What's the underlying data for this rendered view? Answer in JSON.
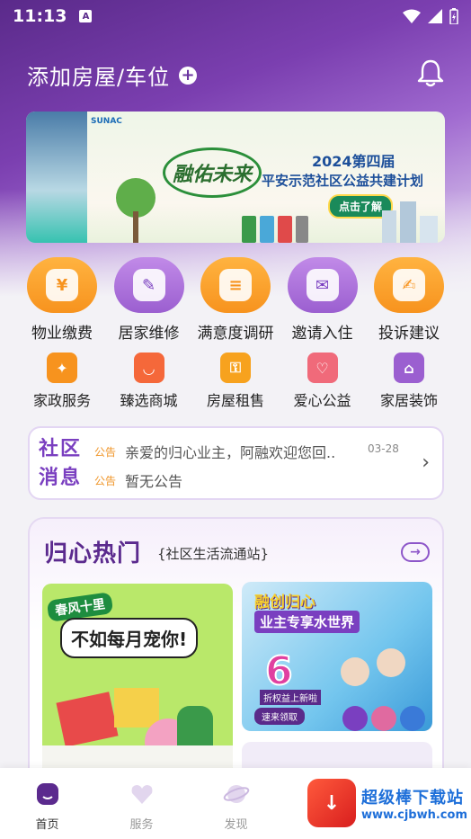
{
  "status": {
    "time": "11:13",
    "sim": "A"
  },
  "header": {
    "title": "添加房屋/车位",
    "plus": "+"
  },
  "banner": {
    "logo": "SUNAC",
    "slogan": "融佑未来",
    "year_line": "2024第四届",
    "sub_line": "平安示范社区公益共建计划",
    "cta": "点击了解"
  },
  "services_main": [
    {
      "label": "物业缴费",
      "glyph": "¥",
      "icon": "property-fee-icon",
      "color": "orange"
    },
    {
      "label": "居家维修",
      "glyph": "✎",
      "icon": "home-repair-icon",
      "color": "purple"
    },
    {
      "label": "满意度调研",
      "glyph": "≡",
      "icon": "survey-icon",
      "color": "orange"
    },
    {
      "label": "邀请入住",
      "glyph": "✉",
      "icon": "invite-icon",
      "color": "purple"
    },
    {
      "label": "投诉建议",
      "glyph": "✍",
      "icon": "complaint-icon",
      "color": "orange"
    }
  ],
  "services_sub": [
    {
      "label": "家政服务",
      "glyph": "✦",
      "icon": "housekeeping-icon",
      "color": "#f7931e"
    },
    {
      "label": "臻选商城",
      "glyph": "◡",
      "icon": "mall-icon",
      "color": "#f5683a"
    },
    {
      "label": "房屋租售",
      "glyph": "⚿",
      "icon": "rent-sale-icon",
      "color": "#f7a21e"
    },
    {
      "label": "爱心公益",
      "glyph": "♡",
      "icon": "charity-icon",
      "color": "#f06a7a"
    },
    {
      "label": "家居装饰",
      "glyph": "⌂",
      "icon": "decoration-icon",
      "color": "#9b5fd0"
    }
  ],
  "notice": {
    "title": "社区消息",
    "items": [
      {
        "tag": "公告",
        "text": "亲爱的归心业主，阿融欢迎您回..",
        "date": "03-28"
      },
      {
        "tag": "公告",
        "text": "暂无公告"
      }
    ]
  },
  "hot": {
    "title": "归心热门",
    "subtitle": "{社区生活流通站}",
    "card_a": {
      "tag": "春风十里",
      "headline": "不如每月宠你!"
    },
    "card_b": {
      "title": "融创归心",
      "title2": "业主专享水世界",
      "big": "6",
      "sub": "折权益上新啦",
      "cta": "速来领取"
    }
  },
  "nav": [
    {
      "label": "首页",
      "icon": "home-icon",
      "active": true
    },
    {
      "label": "服务",
      "icon": "service-icon",
      "active": false
    },
    {
      "label": "发现",
      "icon": "discover-icon",
      "active": false
    }
  ],
  "watermark": {
    "title": "超级棒下载站",
    "url": "www.cjbwh.com"
  },
  "colors": {
    "brand_purple": "#7a3fc0",
    "accent_orange": "#f7931e"
  }
}
